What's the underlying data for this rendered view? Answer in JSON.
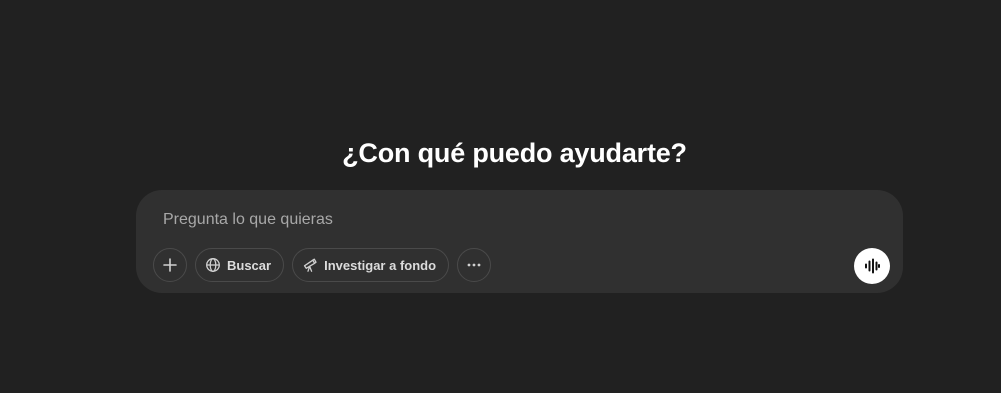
{
  "heading": "¿Con qué puedo ayudarte?",
  "composer": {
    "placeholder": "Pregunta lo que quieras",
    "value": "",
    "tools": {
      "search_label": "Buscar",
      "research_label": "Investigar a fondo"
    },
    "icons": {
      "add": "plus-icon",
      "search": "globe-icon",
      "research": "telescope-icon",
      "more": "ellipsis-icon",
      "voice": "voice-waveform-icon"
    }
  },
  "colors": {
    "background": "#212121",
    "composer": "#303030",
    "voice_button": "#ffffff"
  }
}
